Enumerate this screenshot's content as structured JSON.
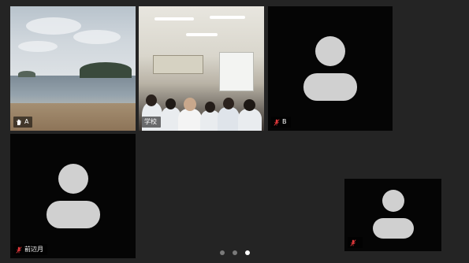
{
  "participants": {
    "a": {
      "name": "A",
      "audio_icon": "hand-raised-icon"
    },
    "school": {
      "name": "学校"
    },
    "b": {
      "name": "B",
      "audio_icon": "mic-muted-icon"
    },
    "d": {
      "name": "前辺月",
      "audio_icon": "mic-muted-icon"
    },
    "e": {
      "name": "",
      "audio_icon": "mic-muted-icon"
    }
  },
  "pagination": {
    "pages": 3,
    "current_page": 3
  },
  "colors": {
    "active_speaker_border": "#3fb24a",
    "mic_muted": "#e0383b",
    "avatar": "#d0d0d0",
    "tile_bg": "#050505",
    "stage_bg": "#242424"
  }
}
